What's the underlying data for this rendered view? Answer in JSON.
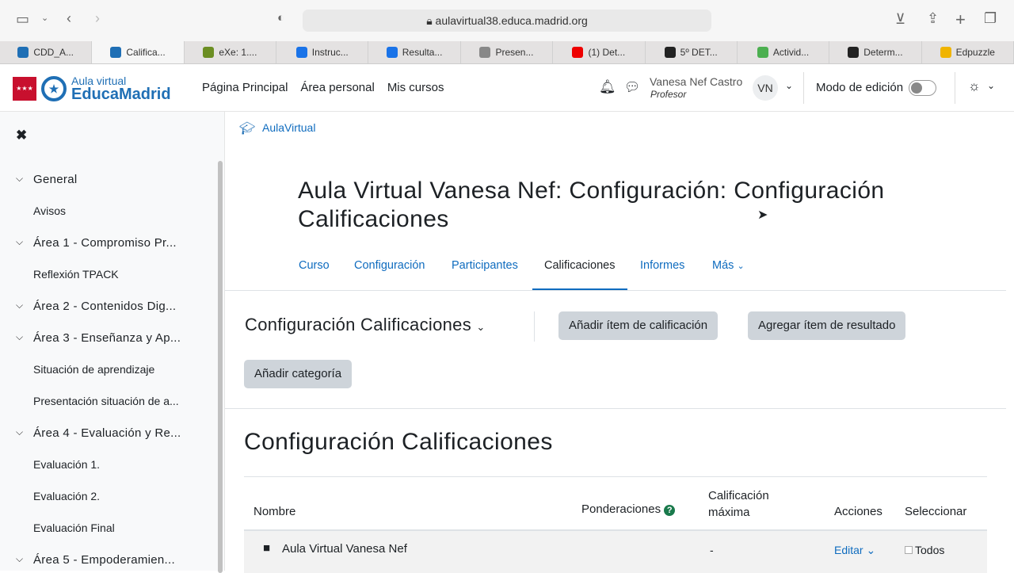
{
  "browser": {
    "url": "aulavirtual38.educa.madrid.org"
  },
  "tabs": [
    {
      "label": "CDD_A...",
      "color": "#1f6fb5"
    },
    {
      "label": "Califica...",
      "color": "#1f6fb5",
      "active": true
    },
    {
      "label": "eXe: 1....",
      "color": "#6b8e23"
    },
    {
      "label": "Instruc...",
      "color": "#1a73e8"
    },
    {
      "label": "Resulta...",
      "color": "#1a73e8"
    },
    {
      "label": "Presen...",
      "color": "#888"
    },
    {
      "label": "(1) Det...",
      "color": "#e00"
    },
    {
      "label": "5º DET...",
      "color": "#222"
    },
    {
      "label": "Activid...",
      "color": "#4caf50"
    },
    {
      "label": "Determ...",
      "color": "#222"
    },
    {
      "label": "Edpuzzle",
      "color": "#f0b400"
    }
  ],
  "logo": {
    "line1": "Aula virtual",
    "line2": "EducaMadrid"
  },
  "nav": {
    "items": [
      "Página Principal",
      "Área personal",
      "Mis cursos"
    ],
    "user_name": "Vanesa Nef Castro",
    "user_role": "Profesor",
    "avatar": "VN",
    "edit_mode": "Modo de edición",
    "edit_mode_on": false
  },
  "sidebar": {
    "items": [
      {
        "label": "General",
        "section": true
      },
      {
        "label": "Avisos"
      },
      {
        "label": "Área 1 - Compromiso Pr...",
        "section": true
      },
      {
        "label": "Reflexión TPACK"
      },
      {
        "label": "Área 2 - Contenidos Dig...",
        "section": true
      },
      {
        "label": "Área 3 - Enseñanza y Ap...",
        "section": true
      },
      {
        "label": "Situación de aprendizaje"
      },
      {
        "label": "Presentación situación de a..."
      },
      {
        "label": "Área 4 - Evaluación y Re...",
        "section": true
      },
      {
        "label": "Evaluación 1."
      },
      {
        "label": "Evaluación 2."
      },
      {
        "label": "Evaluación Final"
      },
      {
        "label": "Área 5 - Empoderamien...",
        "section": true
      }
    ]
  },
  "breadcrumb": "AulaVirtual",
  "page_title": "Aula Virtual Vanesa Nef: Configuración: Configuración Calificaciones",
  "course_tabs": [
    "Curso",
    "Configuración",
    "Participantes",
    "Calificaciones",
    "Informes",
    "Más"
  ],
  "active_tab": "Calificaciones",
  "selector": "Configuración Calificaciones",
  "buttons": {
    "add_item": "Añadir ítem de calificación",
    "add_outcome": "Agregar ítem de resultado",
    "add_category": "Añadir categoría"
  },
  "section_title": "Configuración Calificaciones",
  "table": {
    "headers": {
      "name": "Nombre",
      "weights": "Ponderaciones",
      "max": "Calificación máxima",
      "actions": "Acciones",
      "select": "Seleccionar"
    },
    "rows": [
      {
        "name": "Aula Virtual Vanesa Nef",
        "max": "-",
        "action": "Editar",
        "select": "Todos"
      }
    ]
  }
}
